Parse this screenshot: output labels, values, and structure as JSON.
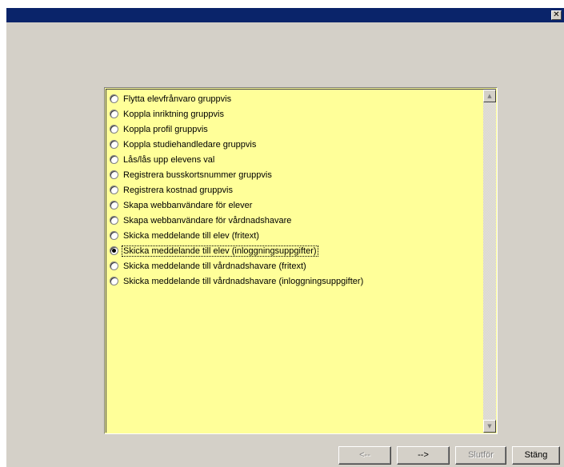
{
  "window": {
    "close_glyph": "✕"
  },
  "options": [
    {
      "label": "Flytta elevfrånvaro gruppvis",
      "checked": false
    },
    {
      "label": "Koppla inriktning gruppvis",
      "checked": false
    },
    {
      "label": "Koppla profil gruppvis",
      "checked": false
    },
    {
      "label": "Koppla studiehandledare gruppvis",
      "checked": false
    },
    {
      "label": "Lås/lås upp elevens val",
      "checked": false
    },
    {
      "label": "Registrera busskortsnummer gruppvis",
      "checked": false
    },
    {
      "label": "Registrera kostnad gruppvis",
      "checked": false
    },
    {
      "label": "Skapa webbanvändare för elever",
      "checked": false
    },
    {
      "label": "Skapa webbanvändare för vårdnadshavare",
      "checked": false
    },
    {
      "label": "Skicka meddelande till elev (fritext)",
      "checked": false
    },
    {
      "label": "Skicka meddelande till elev (inloggningsuppgifter)",
      "checked": true
    },
    {
      "label": "Skicka meddelande till vårdnadshavare (fritext)",
      "checked": false
    },
    {
      "label": "Skicka meddelande till vårdnadshavare (inloggningsuppgifter)",
      "checked": false
    }
  ],
  "scrollbar": {
    "up_glyph": "▲",
    "down_glyph": "▼"
  },
  "buttons": {
    "back": "<--",
    "next": "-->",
    "finish": "Slutför",
    "close": "Stäng"
  },
  "colors": {
    "titlebar": "#0a246a",
    "face": "#d4d0c8",
    "list_background": "#ffff99"
  }
}
